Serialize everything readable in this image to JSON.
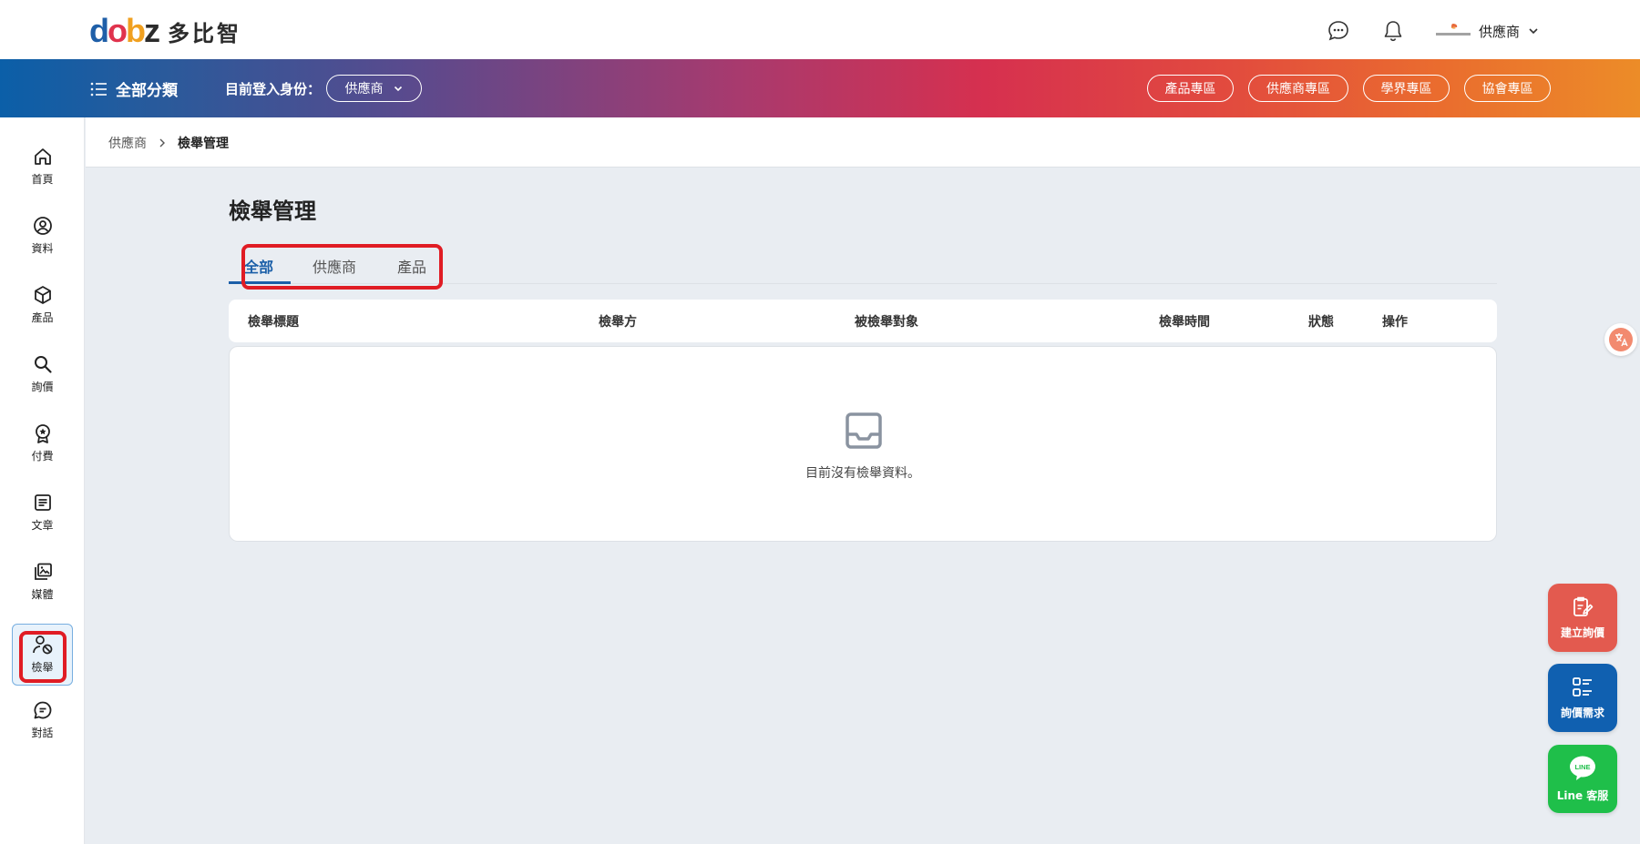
{
  "brand": {
    "mark": [
      "d",
      "o",
      "b",
      "z"
    ],
    "name": "多比智"
  },
  "header": {
    "user_name": "供應商",
    "icons": [
      "chat-icon",
      "bell-icon",
      "chevron-down-icon"
    ]
  },
  "nav": {
    "all_categories": "全部分類",
    "login_as_label": "目前登入身份：",
    "role": "供應商",
    "pills": [
      "產品專區",
      "供應商專區",
      "學界專區",
      "協會專區"
    ]
  },
  "sidebar": {
    "items": [
      {
        "label": "首頁",
        "icon": "home-icon"
      },
      {
        "label": "資料",
        "icon": "profile-icon"
      },
      {
        "label": "產品",
        "icon": "box-icon"
      },
      {
        "label": "詢價",
        "icon": "search-icon"
      },
      {
        "label": "付費",
        "icon": "badge-icon"
      },
      {
        "label": "文章",
        "icon": "article-icon"
      },
      {
        "label": "媒體",
        "icon": "media-icon"
      },
      {
        "label": "檢舉",
        "icon": "report-user-icon",
        "active": true
      },
      {
        "label": "對話",
        "icon": "message-icon"
      }
    ]
  },
  "breadcrumb": {
    "parent": "供應商",
    "current": "檢舉管理"
  },
  "main": {
    "title": "檢舉管理",
    "tabs": [
      "全部",
      "供應商",
      "產品"
    ],
    "active_tab": "全部",
    "columns": [
      "檢舉標題",
      "檢舉方",
      "被檢舉對象",
      "檢舉時間",
      "狀態",
      "操作"
    ],
    "empty_text": "目前沒有檢舉資料。"
  },
  "fabs": [
    {
      "label": "建立詢價",
      "color": "#e35a4f",
      "icon": "edit-note-icon"
    },
    {
      "label": "詢價需求",
      "color": "#1060b0",
      "icon": "list-icon"
    },
    {
      "label": "Line 客服",
      "color": "#1fbf4a",
      "icon": "line-icon"
    }
  ],
  "colors": {
    "accent": "#1b5fa8",
    "highlight_box": "#e01c24"
  }
}
